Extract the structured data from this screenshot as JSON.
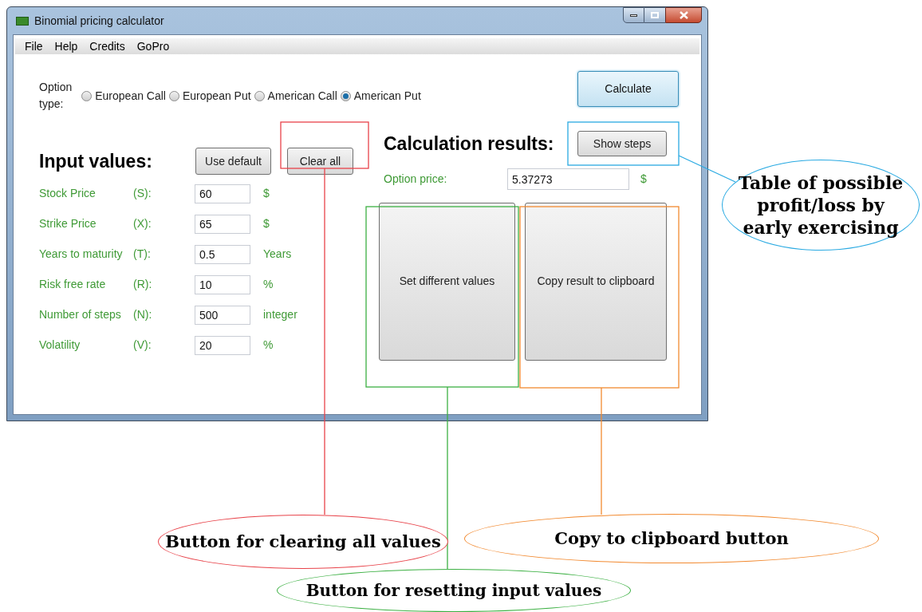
{
  "window": {
    "title": "Binomial pricing calculator"
  },
  "menu": [
    "File",
    "Help",
    "Credits",
    "GoPro"
  ],
  "option_type": {
    "label": "Option type:",
    "options": [
      {
        "label": "European Call",
        "selected": false
      },
      {
        "label": "European Put",
        "selected": false
      },
      {
        "label": "American Call",
        "selected": false
      },
      {
        "label": "American Put",
        "selected": true
      }
    ]
  },
  "calculate_button": "Calculate",
  "inputs": {
    "heading": "Input values:",
    "buttons": [
      "Use default",
      "Clear all"
    ],
    "rows": [
      {
        "label": "Stock Price",
        "symbol": "(S):",
        "value": "60",
        "unit": "$"
      },
      {
        "label": "Strike Price",
        "symbol": "(X):",
        "value": "65",
        "unit": "$"
      },
      {
        "label": "Years to maturity",
        "symbol": "(T):",
        "value": "0.5",
        "unit": "Years"
      },
      {
        "label": "Risk free rate",
        "symbol": "(R):",
        "value": "10",
        "unit": "%"
      },
      {
        "label": "Number of steps",
        "symbol": "(N):",
        "value": "500",
        "unit": "integer"
      },
      {
        "label": "Volatility",
        "symbol": "(V):",
        "value": "20",
        "unit": "%"
      }
    ]
  },
  "results": {
    "heading": "Calculation results:",
    "show_steps_button": "Show steps",
    "option_price": {
      "label": "Option price:",
      "value": "5.37273",
      "unit": "$"
    },
    "buttons": [
      "Set different values",
      "Copy result to clipboard"
    ]
  },
  "annotations": [
    {
      "text": "Table of possible profit/loss by early exercising",
      "color": "#2aaae2"
    },
    {
      "text": "Button for clearing all values",
      "color": "#e8434a"
    },
    {
      "text": "Copy to clipboard button",
      "color": "#f28a30"
    },
    {
      "text": "Button for resetting input values",
      "color": "#3cb043"
    }
  ]
}
